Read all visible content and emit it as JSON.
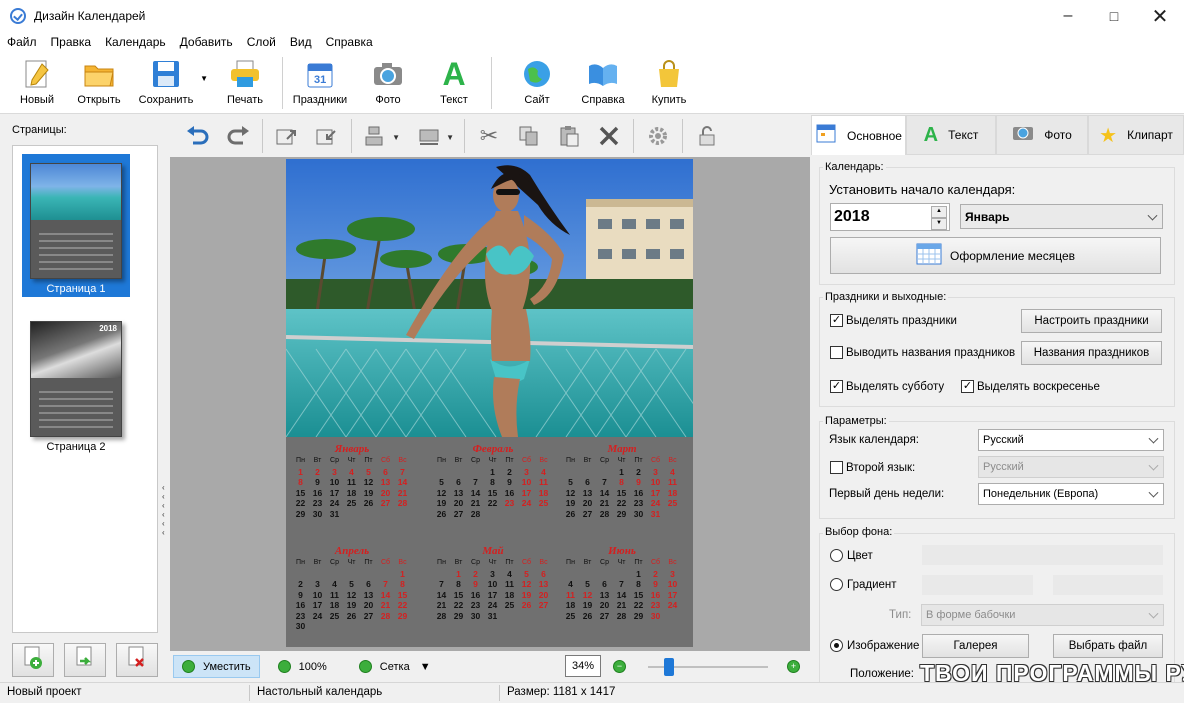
{
  "window": {
    "title": "Дизайн Календарей"
  },
  "menu": [
    "Файл",
    "Правка",
    "Календарь",
    "Добавить",
    "Слой",
    "Вид",
    "Справка"
  ],
  "toolbar": {
    "new": "Новый",
    "open": "Открыть",
    "save": "Сохранить",
    "print": "Печать",
    "holidays": "Праздники",
    "photo": "Фото",
    "text": "Текст",
    "site": "Сайт",
    "help": "Справка",
    "buy": "Купить"
  },
  "pages": {
    "label": "Страницы:",
    "items": [
      {
        "label": "Страница 1"
      },
      {
        "label": "Страница 2"
      }
    ],
    "thumb_year": "2018"
  },
  "zoombar": {
    "fit": "Уместить",
    "hundred": "100%",
    "grid": "Сетка",
    "zoom_value": "34%",
    "zoom_level": 0.34
  },
  "calendar": {
    "weekdays": [
      "Пн",
      "Вт",
      "Ср",
      "Чт",
      "Пт",
      "Сб",
      "Вс"
    ],
    "months": [
      {
        "name": "Январь",
        "rows": [
          [
            "1",
            "2",
            "3",
            "4",
            "5",
            "6",
            "7"
          ],
          [
            "8",
            "9",
            "10",
            "11",
            "12",
            "13",
            "14"
          ],
          [
            "15",
            "16",
            "17",
            "18",
            "19",
            "20",
            "21"
          ],
          [
            "22",
            "23",
            "24",
            "25",
            "26",
            "27",
            "28"
          ],
          [
            "29",
            "30",
            "31",
            "",
            "",
            "",
            ""
          ]
        ]
      },
      {
        "name": "Февраль",
        "rows": [
          [
            "",
            "",
            "",
            "1",
            "2",
            "3",
            "4"
          ],
          [
            "5",
            "6",
            "7",
            "8",
            "9",
            "10",
            "11"
          ],
          [
            "12",
            "13",
            "14",
            "15",
            "16",
            "17",
            "18"
          ],
          [
            "19",
            "20",
            "21",
            "22",
            "23",
            "24",
            "25"
          ],
          [
            "26",
            "27",
            "28",
            "",
            "",
            "",
            ""
          ]
        ]
      },
      {
        "name": "Март",
        "rows": [
          [
            "",
            "",
            "",
            "1",
            "2",
            "3",
            "4"
          ],
          [
            "5",
            "6",
            "7",
            "8",
            "9",
            "10",
            "11"
          ],
          [
            "12",
            "13",
            "14",
            "15",
            "16",
            "17",
            "18"
          ],
          [
            "19",
            "20",
            "21",
            "22",
            "23",
            "24",
            "25"
          ],
          [
            "26",
            "27",
            "28",
            "29",
            "30",
            "31",
            ""
          ]
        ]
      },
      {
        "name": "Апрель",
        "rows": [
          [
            "",
            "",
            "",
            "",
            "",
            "",
            "1"
          ],
          [
            "2",
            "3",
            "4",
            "5",
            "6",
            "7",
            "8"
          ],
          [
            "9",
            "10",
            "11",
            "12",
            "13",
            "14",
            "15"
          ],
          [
            "16",
            "17",
            "18",
            "19",
            "20",
            "21",
            "22"
          ],
          [
            "23",
            "24",
            "25",
            "26",
            "27",
            "28",
            "29"
          ],
          [
            "30",
            "",
            "",
            "",
            "",
            "",
            ""
          ]
        ]
      },
      {
        "name": "Май",
        "rows": [
          [
            "",
            "1",
            "2",
            "3",
            "4",
            "5",
            "6"
          ],
          [
            "7",
            "8",
            "9",
            "10",
            "11",
            "12",
            "13"
          ],
          [
            "14",
            "15",
            "16",
            "17",
            "18",
            "19",
            "20"
          ],
          [
            "21",
            "22",
            "23",
            "24",
            "25",
            "26",
            "27"
          ],
          [
            "28",
            "29",
            "30",
            "31",
            "",
            "",
            ""
          ]
        ]
      },
      {
        "name": "Июнь",
        "rows": [
          [
            "",
            "",
            "",
            "",
            "1",
            "2",
            "3"
          ],
          [
            "4",
            "5",
            "6",
            "7",
            "8",
            "9",
            "10"
          ],
          [
            "11",
            "12",
            "13",
            "14",
            "15",
            "16",
            "17"
          ],
          [
            "18",
            "19",
            "20",
            "21",
            "22",
            "23",
            "24"
          ],
          [
            "25",
            "26",
            "27",
            "28",
            "29",
            "30",
            ""
          ]
        ]
      }
    ],
    "red_days": {
      "Январь": [
        "1",
        "2",
        "3",
        "4",
        "5",
        "6",
        "7",
        "8"
      ],
      "Февраль": [
        "23"
      ],
      "Март": [
        "8",
        "9"
      ],
      "Май": [
        "1",
        "2",
        "9"
      ],
      "Июнь": [
        "11",
        "12"
      ]
    }
  },
  "tabs": [
    {
      "label": "Основное"
    },
    {
      "label": "Текст"
    },
    {
      "label": "Фото"
    },
    {
      "label": "Клипарт"
    }
  ],
  "panel": {
    "calendar_group": "Календарь:",
    "start_label": "Установить начало календаря:",
    "year": "2018",
    "month": "Январь",
    "months_design_button": "Оформление месяцев",
    "holidays_group": "Праздники и выходные:",
    "highlight_holidays": "Выделять праздники",
    "configure_holidays": "Настроить праздники",
    "show_holiday_names": "Выводить названия праздников",
    "holiday_names": "Названия праздников",
    "highlight_saturday": "Выделять субботу",
    "highlight_sunday": "Выделять воскресенье",
    "params_group": "Параметры:",
    "language_label": "Язык календаря:",
    "language_value": "Русский",
    "second_language": "Второй язык:",
    "second_language_value": "Русский",
    "first_day_label": "Первый день недели:",
    "first_day_value": "Понедельник (Европа)",
    "background_group": "Выбор фона:",
    "bg_color": "Цвет",
    "bg_gradient": "Градиент",
    "type_label": "Тип:",
    "type_value": "В форме бабочки",
    "bg_image": "Изображение",
    "gallery_button": "Галерея",
    "choose_file_button": "Выбрать файл",
    "position_label": "Положение:"
  },
  "status": {
    "project": "Новый проект",
    "type": "Настольный календарь",
    "size": "Размер: 1181 x 1417"
  },
  "watermark": "ТВОИ ПРОГРАММЫ РУ",
  "colors": {
    "accent": "#1e78d7",
    "holiday_red": "#d42020",
    "canvas_bg": "#a9a9a9"
  }
}
